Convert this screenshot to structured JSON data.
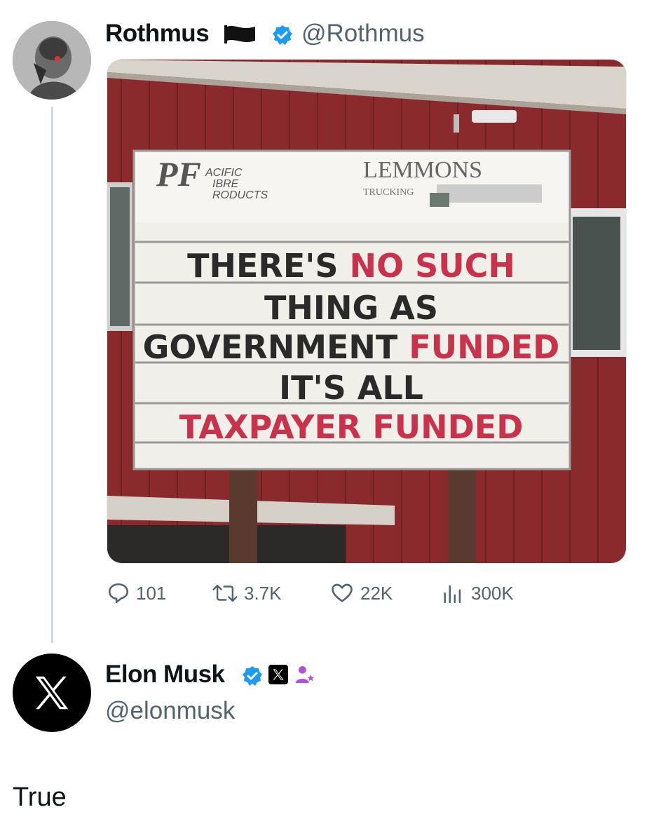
{
  "original_tweet": {
    "author_name": "Rothmus",
    "handle": "@Rothmus",
    "flag_icon": "black-flag-icon",
    "verified_icon": "verified-badge-icon",
    "photo": {
      "sign_top_left": "PACIFIC FIBRE PRODUCTS",
      "sign_top_right_brand": "LEMMONS",
      "sign_top_right_sub": "TRUCKING",
      "sign_lines": [
        [
          {
            "t": "THERE'S ",
            "c": "#2a2a2a"
          },
          {
            "t": "NO SUCH",
            "c": "#c8324a"
          }
        ],
        [
          {
            "t": "THING AS",
            "c": "#2a2a2a"
          }
        ],
        [
          {
            "t": "GOVERNMENT ",
            "c": "#2a2a2a"
          },
          {
            "t": "FUNDED",
            "c": "#c8324a"
          }
        ],
        [
          {
            "t": "IT'S ALL",
            "c": "#2a2a2a"
          }
        ],
        [
          {
            "t": "TAXPAYER  FUNDED",
            "c": "#c8324a"
          }
        ]
      ]
    },
    "stats": {
      "replies": "101",
      "reposts": "3.7K",
      "likes": "22K",
      "views": "300K"
    }
  },
  "reply": {
    "author_name": "Elon Musk",
    "handle": "@elonmusk",
    "text": "True",
    "avatar_glyph": "X"
  },
  "colors": {
    "verified": "#1d9bf0",
    "barn": "#8b2a2c",
    "sign_red": "#c8324a",
    "muted": "#536471",
    "affiliate": "#b44fd6"
  }
}
